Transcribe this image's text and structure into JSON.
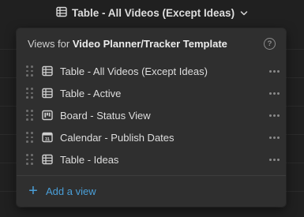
{
  "header": {
    "current_view": "Table - All Videos (Except Ideas)",
    "current_view_icon": "table-icon",
    "chevron": "chevron-down-icon"
  },
  "dropdown": {
    "title_prefix": "Views for ",
    "title_db": "Video Planner/Tracker Template",
    "help_icon_text": "?",
    "items": [
      {
        "label": "Table - All Videos (Except Ideas)",
        "icon": "table-icon"
      },
      {
        "label": "Table - Active",
        "icon": "table-icon"
      },
      {
        "label": "Board - Status View",
        "icon": "board-icon"
      },
      {
        "label": "Calendar - Publish Dates",
        "icon": "calendar-icon",
        "icon_text": "31"
      },
      {
        "label": "Table - Ideas",
        "icon": "table-icon"
      }
    ],
    "add_view_plus": "+",
    "add_view_label": "Add a view"
  },
  "colors": {
    "background": "#202020",
    "menu_bg": "#2f2f2f",
    "accent_blue": "#4a9fd8",
    "text": "#dedede",
    "muted": "#8a8a8a"
  }
}
